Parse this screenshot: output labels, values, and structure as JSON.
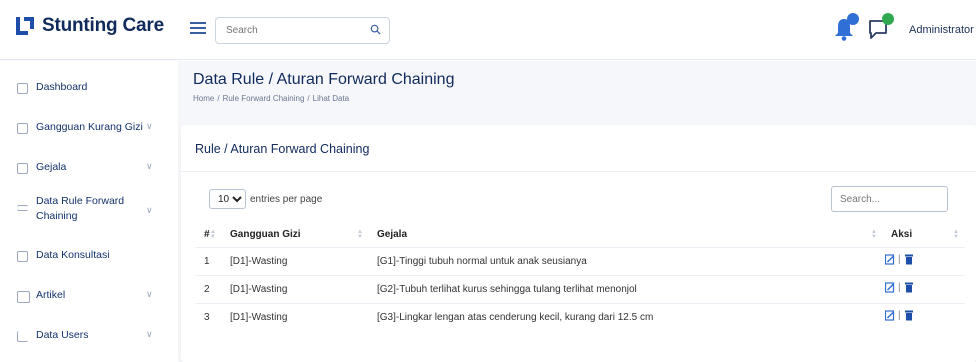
{
  "app": {
    "name": "Stunting Care",
    "brand_color": "#1e4fa8"
  },
  "header": {
    "search_placeholder": "Search",
    "notification_count": "",
    "message_count": "",
    "user_name": "Administrator"
  },
  "sidebar": {
    "items": [
      {
        "label": "Dashboard",
        "icon": "grid-icon",
        "has_submenu": false
      },
      {
        "label": "Gangguan Kurang Gizi",
        "icon": "list-icon",
        "has_submenu": true
      },
      {
        "label": "Gejala",
        "icon": "document-icon",
        "has_submenu": true
      },
      {
        "label": "Data Rule Forward Chaining",
        "icon": "rule-icon",
        "has_submenu": true
      },
      {
        "label": "Data Konsultasi",
        "icon": "table-icon",
        "has_submenu": false
      },
      {
        "label": "Artikel",
        "icon": "article-icon",
        "has_submenu": true
      },
      {
        "label": "Data Users",
        "icon": "users-icon",
        "has_submenu": true
      }
    ]
  },
  "page": {
    "title": "Data Rule / Aturan Forward Chaining",
    "breadcrumb": [
      "Home",
      "Rule Forward Chaining",
      "Lihat Data"
    ]
  },
  "card": {
    "title": "Rule / Aturan Forward Chaining",
    "per_page_value": "10",
    "per_page_label": "entries per page",
    "search_placeholder": "Search...",
    "columns": [
      "#",
      "Gangguan Gizi",
      "Gejala",
      "Aksi"
    ],
    "rows": [
      {
        "no": "1",
        "gangguan": "[D1]-Wasting",
        "gejala": "[G1]-Tinggi tubuh normal untuk anak seusianya"
      },
      {
        "no": "2",
        "gangguan": "[D1]-Wasting",
        "gejala": "[G2]-Tubuh terlihat kurus sehingga tulang terlihat menonjol"
      },
      {
        "no": "3",
        "gangguan": "[D1]-Wasting",
        "gejala": "[G3]-Lingkar lengan atas cenderung kecil, kurang dari 12.5 cm"
      }
    ],
    "action_separator": "|"
  },
  "colors": {
    "primary": "#1e4fa8",
    "notification_badge": "#2f6fd6",
    "message_badge": "#2fa84f",
    "background": "#f5f7fb"
  }
}
